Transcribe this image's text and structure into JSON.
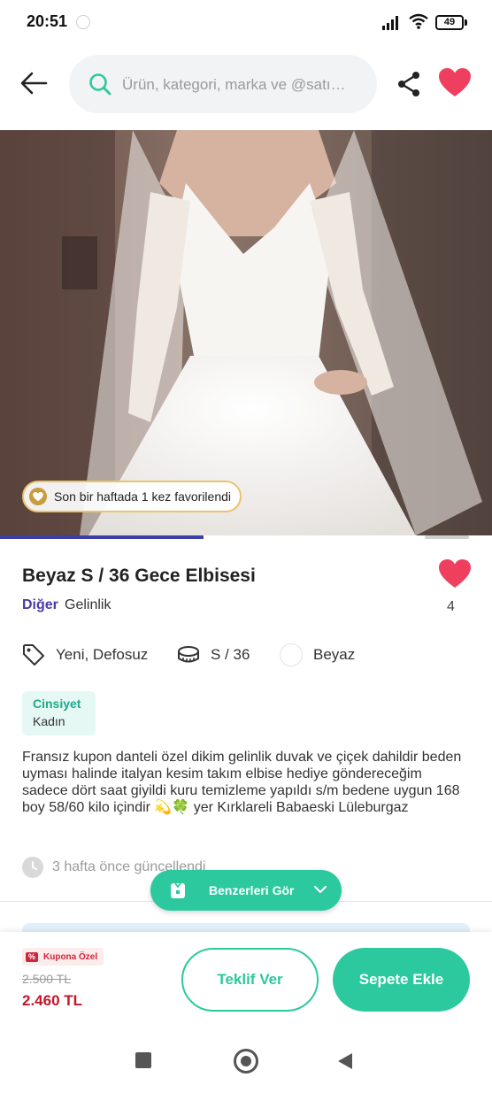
{
  "status_bar": {
    "time": "20:51",
    "battery": "49"
  },
  "header": {
    "search_placeholder": "Ürün, kategori, marka ve @satı…"
  },
  "hero": {
    "favorite_badge": "Son bir haftada 1 kez favorilendi"
  },
  "product": {
    "title": "Beyaz S / 36 Gece Elbisesi",
    "brand": "Diğer",
    "category": "Gelinlik",
    "like_count": "4",
    "attributes": {
      "condition": "Yeni, Defosuz",
      "size": "S / 36",
      "color": "Beyaz"
    },
    "gender": {
      "label": "Cinsiyet",
      "value": "Kadın"
    },
    "description": "Fransız kupon danteli özel dikim gelinlik duvak ve çiçek dahildir beden uyması halinde italyan kesim takım elbise hediye göndereceğim sadece dört saat giyildi kuru temizleme yapıldı s/m bedene uygun 168 boy 58/60 kilo içindir 💫🍀 yer Kırklareli Babaeski Lüleburgaz",
    "updated": "3 hafta önce güncellendi"
  },
  "similar_button": {
    "label": "Benzerleri Gör"
  },
  "bottom_bar": {
    "coupon_label": "Kupona Özel",
    "old_price": "2.500 TL",
    "price": "2.460 TL",
    "offer_label": "Teklif Ver",
    "cart_label": "Sepete Ekle"
  },
  "colors": {
    "accent": "#2cc99e",
    "brand": "#4a3aa8",
    "heart": "#ef3f5f",
    "price": "#c4162a"
  },
  "icons": [
    "back-arrow-icon",
    "search-icon",
    "share-icon",
    "heart-icon",
    "tag-icon",
    "tape-measure-icon",
    "clock-icon",
    "hanger-icon",
    "chevron-down-icon"
  ]
}
